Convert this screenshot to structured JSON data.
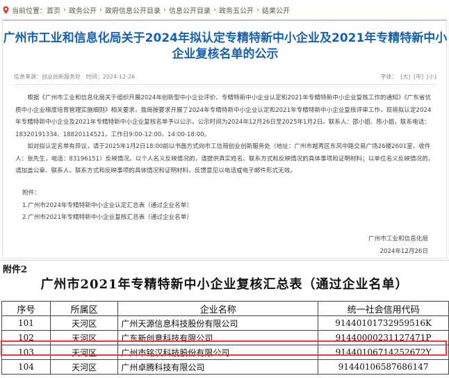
{
  "breadcrumb": {
    "current_label": "当前位置：",
    "items": [
      "首页",
      "政务公开",
      "政府信息公开目录",
      "信息公开目录",
      "政务五公开",
      "结果公开"
    ],
    "separator": "›"
  },
  "article": {
    "title": "广州市工业和信息化局关于2024年拟认定专精特新中小企业及2021年专精特新中小企业复核名单的公示",
    "source": "信息来源：创业创新服务处",
    "time": "时间：2024-12-26",
    "font_size_label": "字体：",
    "font_sizes": [
      "[大]",
      "[中]",
      "[小]"
    ],
    "paragraphs": [
      "根据《广州市工业和信息化局关于组织开展2024年创新型中小企业评价、专精特新中小企业认定和2021年专精特新中小企业复核工作的通知》《广东省优质中小企业梯度培育管理实施细则》相关要求，我局按要求开展了2024年专精特新中小企业认定和2021年专精特新中小企业复核评审工作，现将拟认定2024年专精特新中小企业及2021年专精特新中小企业复核名单予以公示。公示时间为2024年12月26日至2025年1月2日。联系人：邵小姐、陈小姐，联系电话：18320191334、18820114521，工作日9:00-12:00、14:00-18:00。",
      "如对拟认定名单有异议，请于2025年1月2日18:00前以书面方式向市工信局创业创新服务处（地址：广州市越秀区东风中路交易广场26楼2601室，收件人：张先生，电话：83196151）反映情况。以个人名义反映情况的，请提供真实姓名、联系方式和反映情况的具体事项和证明材料；以单位名义反映情况的，请加盖公章、联系人、联系方式和反映事项的具体情况和证明材料。反馈意见以电话或电子邮件形式无效。"
    ],
    "attachments_label": "附件：",
    "attachments": [
      "1.广州市2024年专精特新中小企业认定汇总表（通过企业名单）",
      "2.广州市2021年专精特新中小企业复核汇总表（通过企业名单）"
    ],
    "signer": "广州市工业和信息化局",
    "sign_date": "2024年12月26日"
  },
  "sheet": {
    "attachment_label": "附件2",
    "title": "广州市2021年专精特新中小企业复核汇总表（通过企业名单）",
    "headers": [
      "序号",
      "所属区",
      "企业名称",
      "统一社会信用代码"
    ],
    "rows": [
      {
        "no": "101",
        "district": "天河区",
        "name": "广州天源信息科技股份有限公司",
        "code": "91440101732959516K"
      },
      {
        "no": "102",
        "district": "天河区",
        "name": "广东新创意科技有限公司",
        "code": "91440000231127471P"
      },
      {
        "no": "103",
        "district": "天河区",
        "name": "广州市铭汉科技股份有限公司",
        "code": "91440106714252672Y"
      },
      {
        "no": "104",
        "district": "天河区",
        "name": "广州卓腾科技有限公司",
        "code": "91440106587686147"
      }
    ],
    "highlighted_row": "103",
    "highlight_color": "#e53935"
  }
}
